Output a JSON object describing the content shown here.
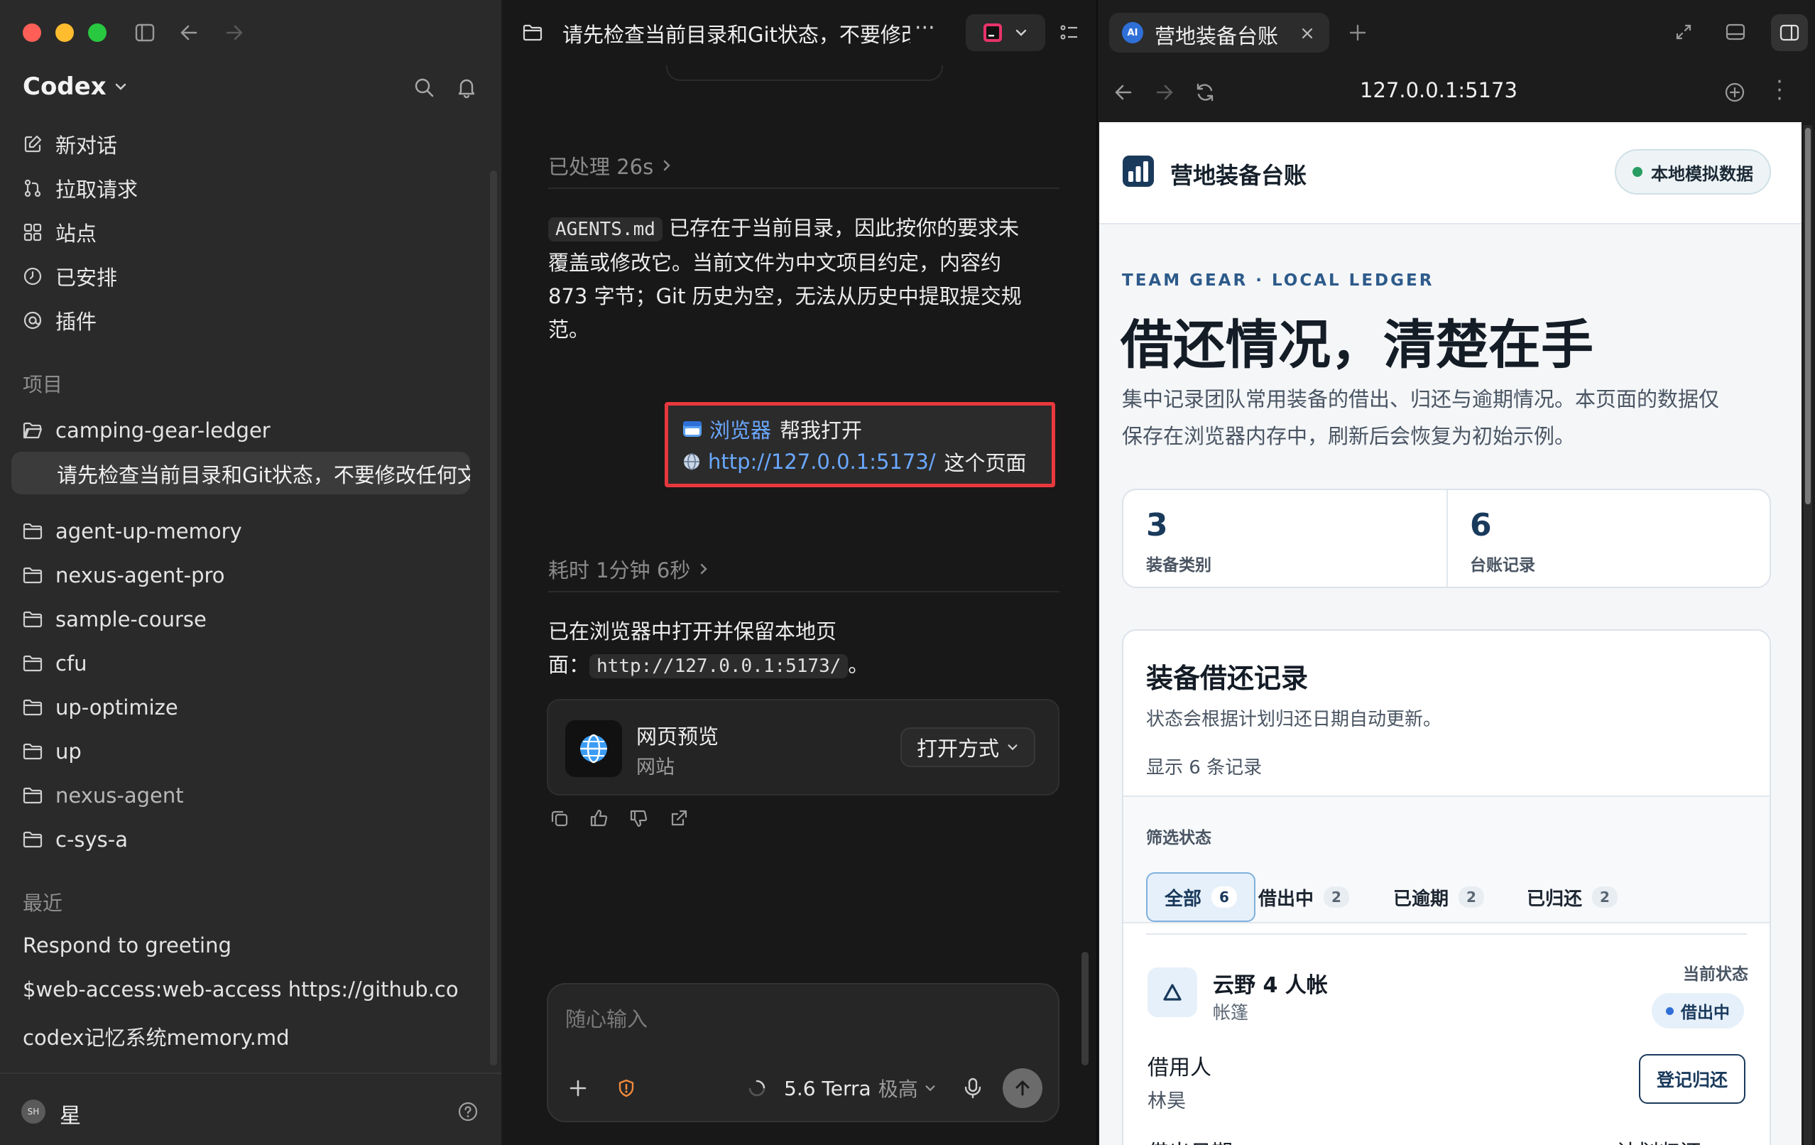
{
  "sidebar": {
    "app_title": "Codex",
    "nav": [
      {
        "label": "新对话",
        "icon": "edit-icon"
      },
      {
        "label": "拉取请求",
        "icon": "pull-request-icon"
      },
      {
        "label": "站点",
        "icon": "grid-icon"
      },
      {
        "label": "已安排",
        "icon": "clock-icon"
      },
      {
        "label": "插件",
        "icon": "plugin-icon"
      }
    ],
    "projects_heading": "项目",
    "projects": [
      "camping-gear-ledger",
      "agent-up-memory",
      "nexus-agent-pro",
      "sample-course",
      "cfu",
      "up-optimize",
      "up",
      "nexus-agent",
      "c-sys-a"
    ],
    "active_thread": "请先检查当前目录和Git状态，不要修改任何文件",
    "recent_heading": "最近",
    "recent": [
      "Respond to greeting",
      "$web-access:web-access https://github.com/",
      "codex记忆系统memory.md"
    ],
    "user": {
      "initials": "SH",
      "name": "星"
    }
  },
  "chat": {
    "title": "请先检查当前目录和Git状态，不要修改任何文件",
    "processed_label": "已处理 26s",
    "msg1_code": "AGENTS.md",
    "msg1_line1": " 已存在于当前目录，因此按你的要求未",
    "msg1_line2": "覆盖或修改它。当前文件为中文项目约定，内容约",
    "msg1_line3": "873 字节；Git 历史为空，无法从历史中提取提交规",
    "msg1_line4": "范。",
    "user_link_app": "浏览器",
    "user_msg_part1": "帮我打开",
    "user_link_url": "http://127.0.0.1:5173/",
    "user_msg_part2": "这个页面",
    "elapsed_label": "耗时 1分钟 6秒",
    "msg2_line1": "已在浏览器中打开并保留本地页",
    "msg2_prefix": "面：",
    "msg2_code": "http://127.0.0.1:5173/",
    "msg2_suffix": "。",
    "preview_title": "网页预览",
    "preview_sub": "网站",
    "open_with": "打开方式",
    "input_placeholder": "随心输入",
    "model": "5.6 Terra",
    "effort": "极高"
  },
  "browser": {
    "tab_title": "营地装备台账",
    "tab_badge": "AI",
    "url": "127.0.0.1:5173",
    "page": {
      "brand": "营地装备台账",
      "status_pill": "本地模拟数据",
      "eyebrow": "TEAM GEAR · LOCAL LEDGER",
      "headline": "借还情况，清楚在手",
      "desc_line1": "集中记录团队常用装备的借出、归还与逾期情况。本页面的数据仅",
      "desc_line2": "保存在浏览器内存中，刷新后会恢复为初始示例。",
      "stats": [
        {
          "value": "3",
          "label": "装备类别"
        },
        {
          "value": "6",
          "label": "台账记录"
        }
      ],
      "records_title": "装备借还记录",
      "records_sub": "状态会根据计划归还日期自动更新。",
      "records_count": "显示 6 条记录",
      "filter_label": "筛选状态",
      "filters": [
        {
          "label": "全部",
          "count": "6"
        },
        {
          "label": "借出中",
          "count": "2"
        },
        {
          "label": "已逾期",
          "count": "2"
        },
        {
          "label": "已归还",
          "count": "2"
        }
      ],
      "item": {
        "name": "云野 4 人帐",
        "category": "帐篷",
        "status_label": "当前状态",
        "status": "借出中",
        "borrower_label": "借用人",
        "borrower": "林昊",
        "return_button": "登记归还",
        "date_label": "借出日期",
        "plan_label": "计划归还"
      }
    }
  },
  "colors": {
    "accent_blue": "#4a8ff0",
    "highlight_red": "#e8383d",
    "brand_navy": "#1a3a5c",
    "status_green": "#2a9d64"
  }
}
